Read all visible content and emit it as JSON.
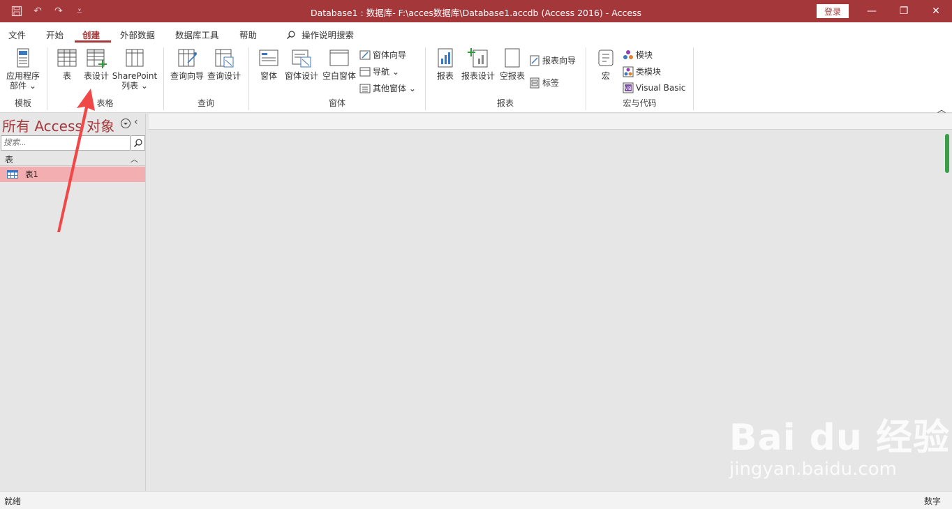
{
  "window": {
    "title": "Database1 : 数据库- F:\\acces数据库\\Database1.accdb (Access 2016)  -  Access",
    "signin_label": "登录",
    "minimize_icon": "minimize-icon",
    "restore_icon": "restore-icon",
    "close_icon": "close-icon"
  },
  "tabs": [
    {
      "label": "文件"
    },
    {
      "label": "开始"
    },
    {
      "label": "创建"
    },
    {
      "label": "外部数据"
    },
    {
      "label": "数据库工具"
    },
    {
      "label": "帮助"
    }
  ],
  "tellme": {
    "label": "操作说明搜索"
  },
  "ribbon": {
    "templates": {
      "label": "模板",
      "app_parts": "应用程序\n部件 ⌄"
    },
    "tables": {
      "label": "表格",
      "table": "表",
      "table_design": "表设计",
      "sharepoint": "SharePoint\n列表 ⌄"
    },
    "queries": {
      "label": "查询",
      "query_wizard": "查询向导",
      "query_design": "查询设计"
    },
    "forms": {
      "label": "窗体",
      "form": "窗体",
      "form_design": "窗体设计",
      "blank_form": "空白窗体",
      "form_wizard": "窗体向导",
      "navigation": "导航 ⌄",
      "more_forms": "其他窗体 ⌄"
    },
    "reports": {
      "label": "报表",
      "report": "报表",
      "report_design": "报表设计",
      "blank_report": "空报表",
      "report_wizard": "报表向导",
      "labels": "标签"
    },
    "macros": {
      "label": "宏与代码",
      "macro": "宏",
      "module": "模块",
      "class_module": "类模块",
      "visual_basic": "Visual Basic"
    }
  },
  "nav": {
    "title": "所有 Access 对象",
    "search_placeholder": "搜索...",
    "section": "表",
    "items": [
      {
        "label": "表1"
      }
    ]
  },
  "status": {
    "left": "就绪",
    "right": "数字"
  },
  "watermark": {
    "main": "Bai du 经验",
    "sub": "jingyan.baidu.com"
  },
  "colors": {
    "accent": "#a4373a",
    "selected_item": "#f2aeb0",
    "annotation_arrow": "#f04848"
  }
}
